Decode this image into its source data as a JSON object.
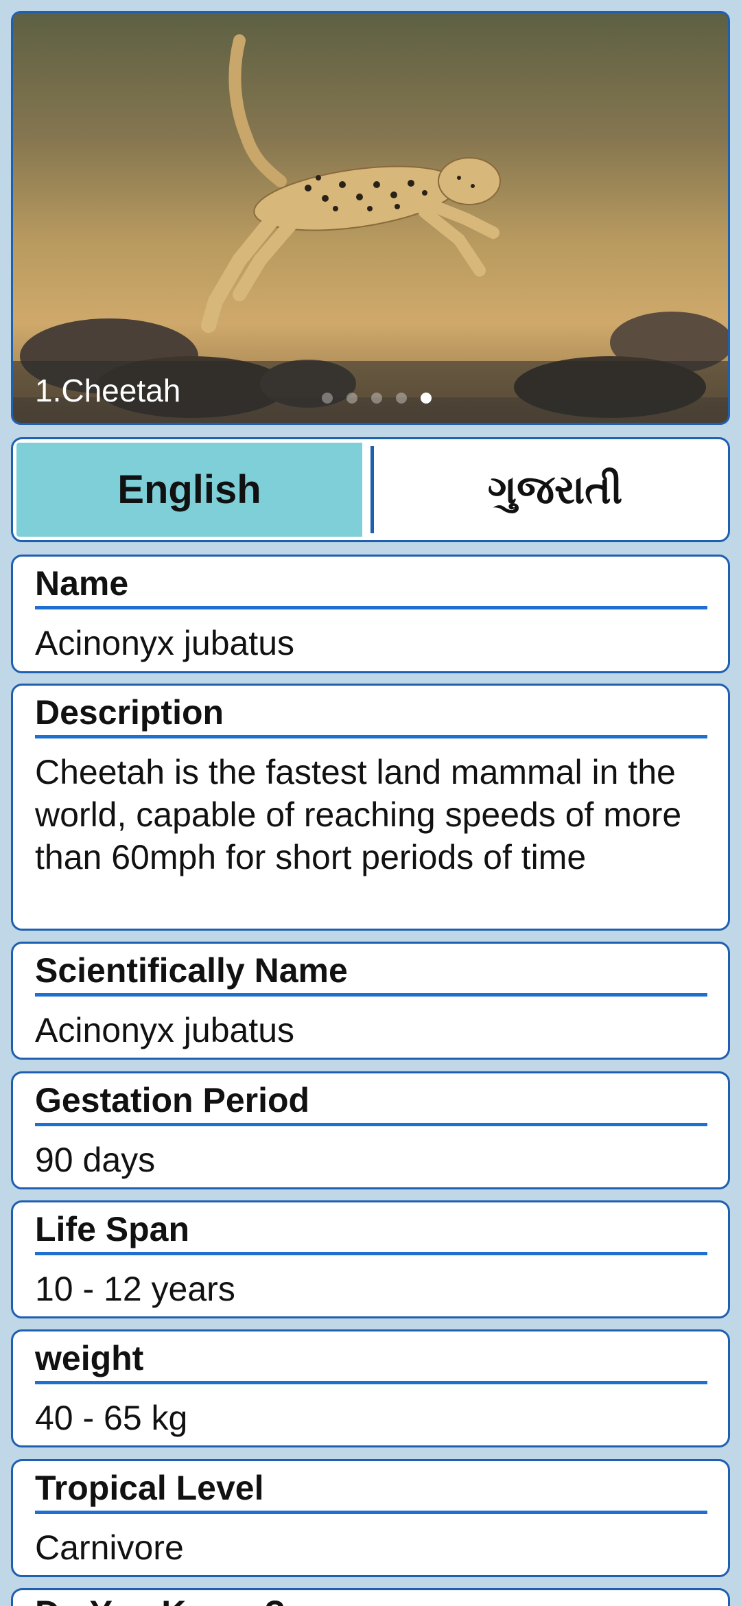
{
  "slider": {
    "caption": "1.Cheetah",
    "dots_total": 5,
    "active_dot": 5
  },
  "language": {
    "english": "English",
    "gujarati": "ગુજરાતી"
  },
  "cards": {
    "name": {
      "title": "Name",
      "value": "Acinonyx jubatus"
    },
    "description": {
      "title": "Description",
      "value": "Cheetah is the fastest land mammal in the world, capable of reaching speeds of more than 60mph for short periods of time"
    },
    "scientific": {
      "title": "Scientifically Name",
      "value": "Acinonyx jubatus"
    },
    "gestation": {
      "title": "Gestation Period",
      "value": "90 days"
    },
    "lifespan": {
      "title": "Life Span",
      "value": "10 - 12 years"
    },
    "weight": {
      "title": "weight",
      "value": "40 - 65 kg"
    },
    "tropical": {
      "title": "Tropical Level",
      "value": "Carnivore"
    },
    "didyouknow": {
      "title": "Do You Know ?"
    }
  },
  "colors": {
    "accent": "#1e5fb0",
    "active_tab": "#7ecfd8",
    "background": "#bfd7e6"
  }
}
